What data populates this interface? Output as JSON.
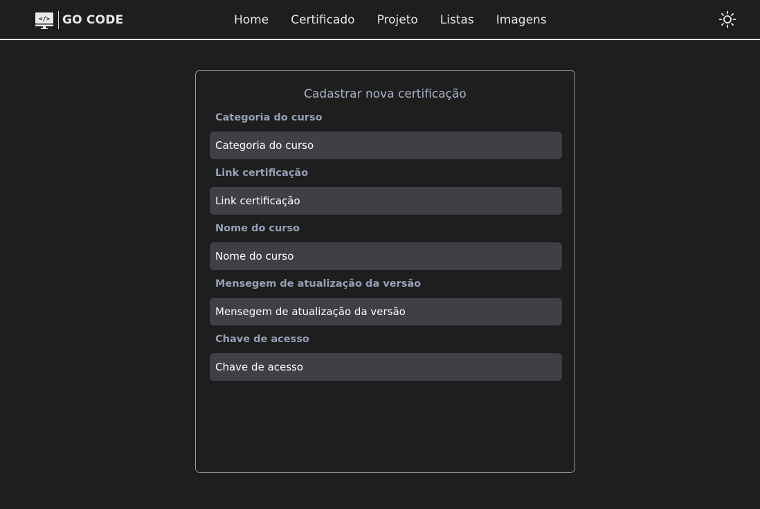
{
  "header": {
    "brand_name": "GO CODE",
    "brand_icon": "code-monitor-icon",
    "theme_icon": "sun-icon",
    "nav": [
      {
        "label": "Home"
      },
      {
        "label": "Certificado"
      },
      {
        "label": "Projeto"
      },
      {
        "label": "Listas"
      },
      {
        "label": "Imagens"
      }
    ]
  },
  "form": {
    "title": "Cadastrar nova certificação",
    "fields": [
      {
        "label": "Categoria do curso",
        "placeholder": "Categoria do curso",
        "value": ""
      },
      {
        "label": "Link certificação",
        "placeholder": "Link certificação",
        "value": ""
      },
      {
        "label": "Nome do curso",
        "placeholder": "Nome do curso",
        "value": ""
      },
      {
        "label": "Mensegem de atualização da versão",
        "placeholder": "Mensegem de atualização da versão",
        "value": ""
      },
      {
        "label": "Chave de acesso",
        "placeholder": "Chave de acesso",
        "value": ""
      }
    ]
  },
  "colors": {
    "background": "#1e1e1e",
    "input_background": "#3f3f45",
    "label": "#95a0b6",
    "title": "#a9b3c6",
    "header_border": "#e9e9e9"
  }
}
